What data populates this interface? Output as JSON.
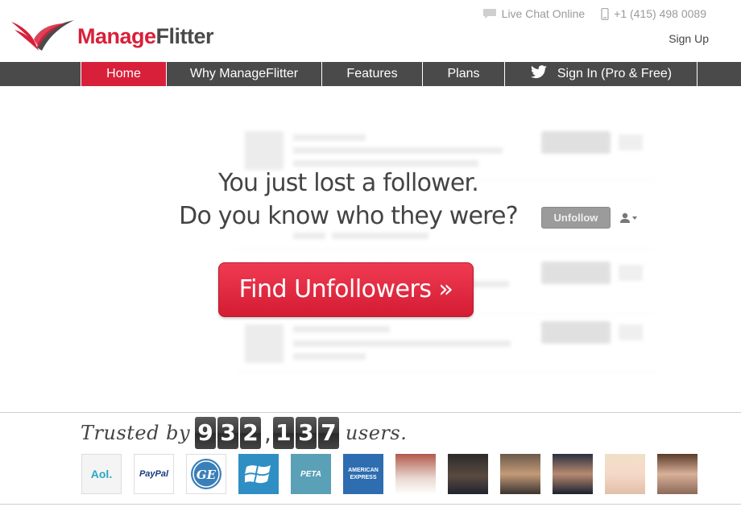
{
  "brand": {
    "name_part1": "Manage",
    "name_part2": "Flitter",
    "red": "#d8203a",
    "dark": "#4a4a4a"
  },
  "contact": {
    "chat_label": "Live Chat Online",
    "phone": "+1 (415) 498 0089",
    "signup": "Sign Up"
  },
  "nav": {
    "items": [
      {
        "label": "Home",
        "active": true
      },
      {
        "label": "Why ManageFlitter"
      },
      {
        "label": "Features"
      },
      {
        "label": "Plans"
      },
      {
        "label": "Sign In (Pro & Free)",
        "icon": "twitter-bird-icon"
      }
    ]
  },
  "hero": {
    "headline_line1": "You just lost a follower.",
    "headline_line2": "Do you know who they were?",
    "cta_label": "Find Unfollowers »",
    "unfollow_label": "Unfollow"
  },
  "trusted": {
    "prefix": "Trusted by",
    "count_digits": [
      "9",
      "3",
      "2",
      "1",
      "3",
      "7"
    ],
    "suffix": "users.",
    "logos": [
      {
        "name": "aol-logo",
        "text": "Aol."
      },
      {
        "name": "paypal-logo",
        "text": "PayPal"
      },
      {
        "name": "ge-logo",
        "text": "GE"
      },
      {
        "name": "windows-logo",
        "text": ""
      },
      {
        "name": "peta-logo",
        "text": "PETA"
      },
      {
        "name": "amex-logo",
        "text": "AMERICAN EXPRESS"
      },
      {
        "name": "person-photo-1",
        "text": ""
      },
      {
        "name": "person-photo-2",
        "text": ""
      },
      {
        "name": "person-photo-3",
        "text": ""
      },
      {
        "name": "person-photo-4",
        "text": ""
      },
      {
        "name": "person-photo-5",
        "text": ""
      },
      {
        "name": "person-photo-6",
        "text": ""
      }
    ]
  }
}
